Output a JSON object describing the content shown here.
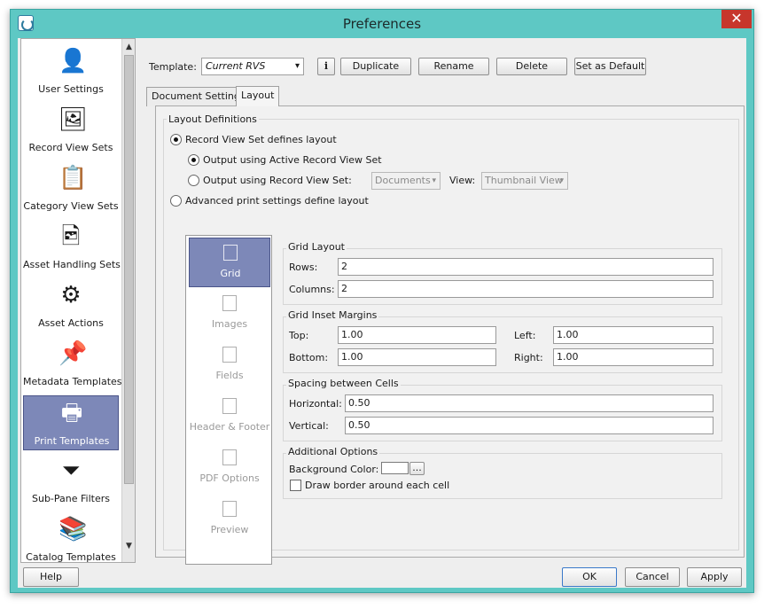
{
  "window": {
    "title": "Preferences",
    "close_glyph": "✕"
  },
  "sidebar": {
    "items": [
      {
        "label": "User Settings",
        "icon": "user-icon",
        "glyph": "👤"
      },
      {
        "label": "Record View Sets",
        "icon": "record-view-icon",
        "glyph": "🖼"
      },
      {
        "label": "Category View Sets",
        "icon": "category-view-icon",
        "glyph": "📋"
      },
      {
        "label": "Asset Handling Sets",
        "icon": "asset-handling-icon",
        "glyph": "🖻"
      },
      {
        "label": "Asset Actions",
        "icon": "gear-icon",
        "glyph": "⚙"
      },
      {
        "label": "Metadata Templates",
        "icon": "stamp-icon",
        "glyph": "📌"
      },
      {
        "label": "Print Templates",
        "icon": "printer-icon",
        "glyph": "🖶"
      },
      {
        "label": "Sub-Pane Filters",
        "icon": "filter-icon",
        "glyph": "⏷"
      },
      {
        "label": "Catalog Templates",
        "icon": "catalog-icon",
        "glyph": "📚"
      }
    ],
    "scroll_up": "▲",
    "scroll_down": "▼"
  },
  "toolbar": {
    "template_label": "Template:",
    "template_value": "Current RVS",
    "info_glyph": "i",
    "duplicate": "Duplicate",
    "rename": "Rename",
    "delete": "Delete",
    "set_default": "Set as Default"
  },
  "tabs": {
    "document_settings": "Document Settings",
    "layout": "Layout"
  },
  "layout": {
    "group_title": "Layout Definitions",
    "rvs_defines": "Record View Set defines layout",
    "active_rvs": "Output using Active Record View Set",
    "using_rvs": "Output using Record View Set:",
    "rvs_combo": "Documents",
    "view_label": "View:",
    "view_combo": "Thumbnail View",
    "advanced": "Advanced print settings define layout",
    "categories": [
      "Grid",
      "Images",
      "Fields",
      "Header & Footer",
      "PDF Options",
      "Preview"
    ],
    "grid_layout": {
      "title": "Grid Layout",
      "rows_label": "Rows:",
      "rows": "2",
      "columns_label": "Columns:",
      "columns": "2"
    },
    "margins": {
      "title": "Grid Inset Margins",
      "top_label": "Top:",
      "top": "1.00",
      "left_label": "Left:",
      "left": "1.00",
      "bottom_label": "Bottom:",
      "bottom": "1.00",
      "right_label": "Right:",
      "right": "1.00"
    },
    "spacing": {
      "title": "Spacing between Cells",
      "horizontal_label": "Horizontal:",
      "horizontal": "0.50",
      "vertical_label": "Vertical:",
      "vertical": "0.50"
    },
    "options": {
      "title": "Additional Options",
      "bg_color_label": "Background Color:",
      "bg_color": "#ffffff",
      "ellipsis": "...",
      "draw_border": "Draw border around each cell"
    }
  },
  "footer": {
    "help": "Help",
    "ok": "OK",
    "cancel": "Cancel",
    "apply": "Apply"
  }
}
